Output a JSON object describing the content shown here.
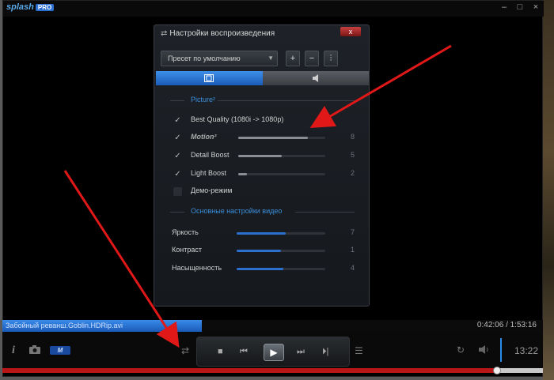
{
  "app": {
    "logo": "splash",
    "logo_badge": "PRO",
    "window_buttons": [
      "–",
      "□",
      "×"
    ]
  },
  "dialog": {
    "title": "Настройки воспроизведения",
    "close_label": "x",
    "preset": {
      "value": "Пресет по умолчанию"
    },
    "tabs": [
      {
        "name": "video-tab",
        "icon": "film-icon",
        "active": true
      },
      {
        "name": "audio-tab",
        "icon": "speaker-icon",
        "active": false
      }
    ],
    "picture_section": "Picture²",
    "picture_items": [
      {
        "label": "Best Quality (1080i -> 1080p)",
        "checked": true
      },
      {
        "label": "Motion²",
        "checked": true,
        "value": "8",
        "level": 0.8
      },
      {
        "label": "Detail Boost",
        "checked": true,
        "value": "5",
        "level": 0.5
      },
      {
        "label": "Light Boost",
        "checked": true,
        "value": "2",
        "level": 0.1
      },
      {
        "label": "Демо-режим",
        "checked": false
      }
    ],
    "video_section": "Основные настройки видео",
    "video_items": [
      {
        "label": "Яркость",
        "value": "7",
        "level": 0.55
      },
      {
        "label": "Контраст",
        "value": "1",
        "level": 0.5
      },
      {
        "label": "Насыщенность",
        "value": "4",
        "level": 0.53
      }
    ]
  },
  "file": {
    "name": "Забойный реванш.Goblin.HDRip.avi",
    "time": "0:42:06 / 1:53:16"
  },
  "controls": {
    "m_label": "M",
    "clock": "13:22",
    "progress": 0.915
  },
  "colors": {
    "accent": "#2b6fd0",
    "progress": "#b81616",
    "arrow": "#e01818"
  }
}
